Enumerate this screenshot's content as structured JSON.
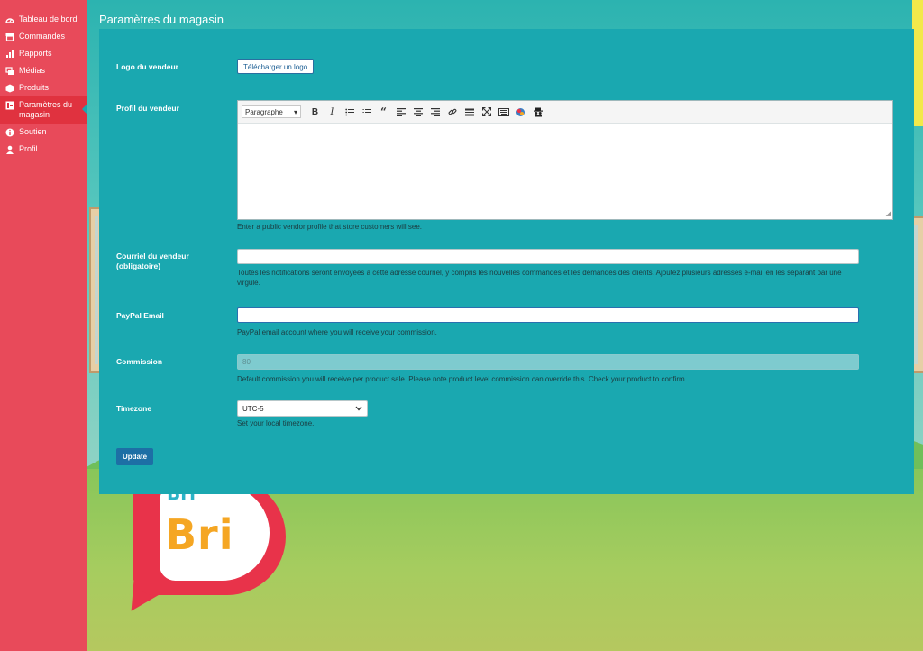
{
  "sidebar": {
    "items": [
      {
        "label": "Tableau de bord",
        "icon": "dashboard-icon"
      },
      {
        "label": "Commandes",
        "icon": "store-icon"
      },
      {
        "label": "Rapports",
        "icon": "bar-chart-icon"
      },
      {
        "label": "Médias",
        "icon": "media-icon"
      },
      {
        "label": "Produits",
        "icon": "box-icon"
      },
      {
        "label": "Paramètres du magasin",
        "icon": "settings-icon",
        "active": true
      },
      {
        "label": "Soutien",
        "icon": "info-icon"
      },
      {
        "label": "Profil",
        "icon": "user-icon"
      }
    ]
  },
  "page": {
    "title": "Paramètres du magasin"
  },
  "form": {
    "logo": {
      "label": "Logo du vendeur",
      "button": "Télécharger un logo"
    },
    "profile": {
      "label": "Profil du vendeur",
      "format": "Paragraphe",
      "help": "Enter a public vendor profile that store customers will see."
    },
    "email": {
      "label": "Courriel du vendeur (obligatoire)",
      "value": "",
      "help": "Toutes les notifications seront envoyées à cette adresse courriel, y compris les nouvelles commandes et les demandes des clients. Ajoutez plusieurs adresses e-mail en les séparant par une virgule."
    },
    "paypal": {
      "label": "PayPal Email",
      "value": "",
      "help": "PayPal email account where you will receive your commission."
    },
    "commission": {
      "label": "Commission",
      "value": "80",
      "help": "Default commission you will receive per product sale. Please note product level commission can override this. Check your product to confirm."
    },
    "timezone": {
      "label": "Timezone",
      "value": "UTC-5",
      "help": "Set your local timezone."
    },
    "update_button": "Update"
  },
  "background": {
    "logo_text": "Bri"
  },
  "colors": {
    "sidebar": "#e84a5a",
    "panel": "#1aa8b0",
    "button": "#1d6fa5"
  }
}
